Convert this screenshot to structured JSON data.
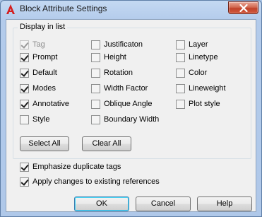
{
  "window": {
    "title": "Block Attribute Settings"
  },
  "group": {
    "title": "Display in list",
    "columns": [
      [
        {
          "label": "Tag",
          "checked": true,
          "disabled": true
        },
        {
          "label": "Prompt",
          "checked": true
        },
        {
          "label": "Default",
          "checked": true
        },
        {
          "label": "Modes",
          "checked": true
        },
        {
          "label": "Annotative",
          "checked": true
        },
        {
          "label": "Style",
          "checked": false
        }
      ],
      [
        {
          "label": "Justificaton",
          "checked": false
        },
        {
          "label": "Height",
          "checked": false
        },
        {
          "label": "Rotation",
          "checked": false
        },
        {
          "label": "Width Factor",
          "checked": false
        },
        {
          "label": "Oblique Angle",
          "checked": false
        },
        {
          "label": "Boundary Width",
          "checked": false
        }
      ],
      [
        {
          "label": "Layer",
          "checked": false
        },
        {
          "label": "Linetype",
          "checked": false
        },
        {
          "label": "Color",
          "checked": false
        },
        {
          "label": "Lineweight",
          "checked": false
        },
        {
          "label": "Plot style",
          "checked": false
        }
      ]
    ],
    "select_all_label": "Select All",
    "clear_all_label": "Clear All"
  },
  "options": {
    "emphasize": {
      "label": "Emphasize duplicate tags",
      "checked": true
    },
    "apply": {
      "label": "Apply changes to existing references",
      "checked": true
    }
  },
  "buttons": {
    "ok": "OK",
    "cancel": "Cancel",
    "help": "Help"
  },
  "icons": {
    "app": "autocad-logo-icon",
    "close": "close-icon"
  },
  "colors": {
    "close_button": "#c9492f",
    "logo": "#d41e1e"
  }
}
